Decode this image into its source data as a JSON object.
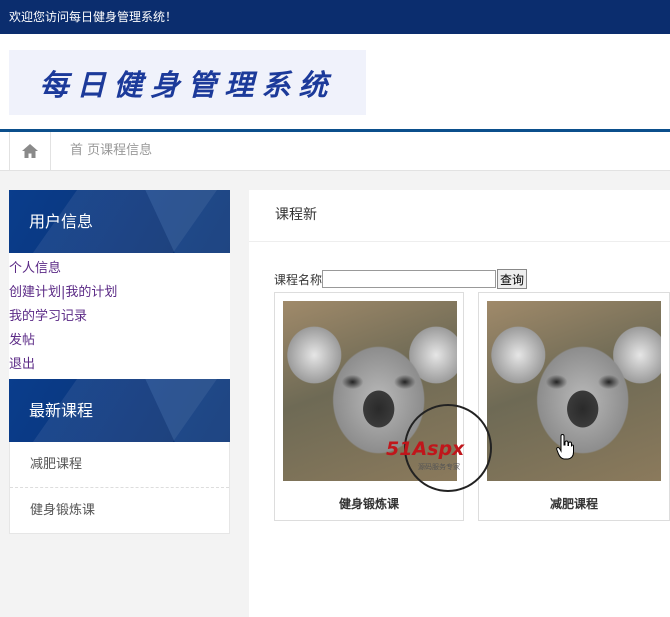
{
  "topbar": {
    "welcome": "欢迎您访问每日健身管理系统！"
  },
  "header": {
    "logo_text": "每日健身管理系统"
  },
  "nav": {
    "breadcrumb": "首 页课程信息",
    "home_icon": "home-icon"
  },
  "sidebar": {
    "user_section_title": "用户信息",
    "user_links": [
      "个人信息",
      "创建计划|我的计划",
      "我的学习记录",
      "发帖",
      "退出"
    ],
    "course_section_title": "最新课程",
    "course_items": [
      "减肥课程",
      "健身锻炼课"
    ]
  },
  "main": {
    "title": "课程新",
    "search": {
      "label": "课程名称",
      "value": "",
      "button": "查询"
    },
    "cards": [
      {
        "title": "健身锻炼课"
      },
      {
        "title": "减肥课程"
      }
    ]
  },
  "watermark": {
    "logo": "51Aspx",
    "sub": "源码服务专家"
  },
  "colors": {
    "topbar": "#0b2d6e",
    "accent": "#0b4f8c",
    "link": "#5b2a86"
  }
}
